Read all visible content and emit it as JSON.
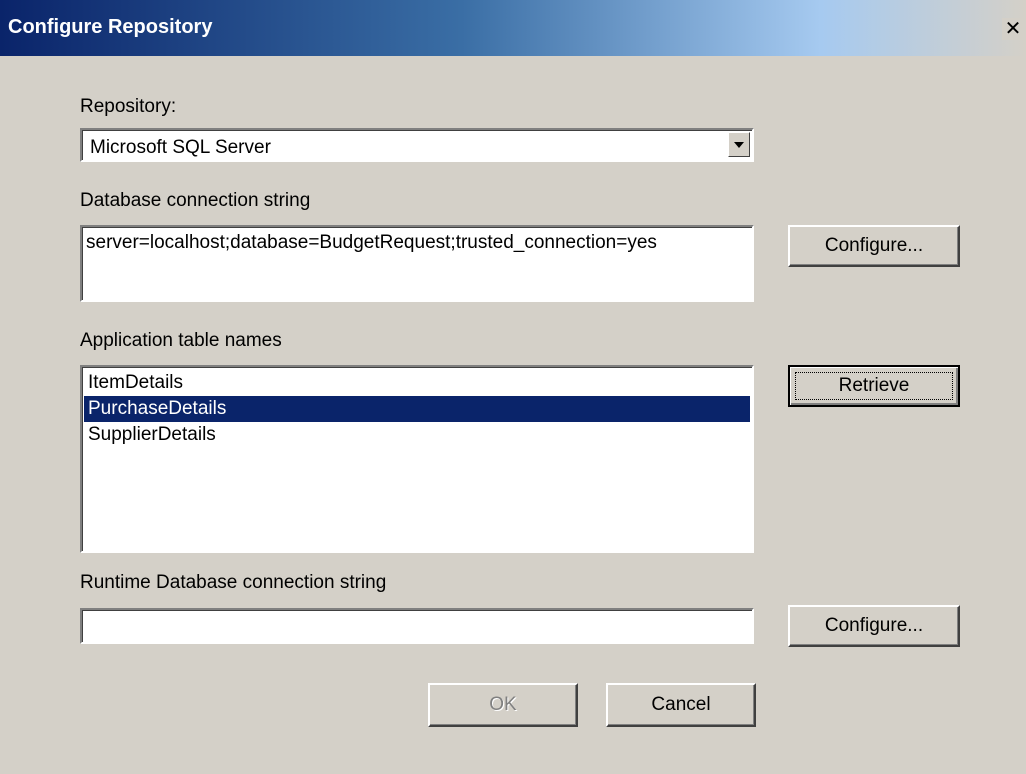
{
  "window": {
    "title": "Configure Repository",
    "close_glyph": "✕"
  },
  "repository": {
    "label": "Repository:",
    "selected": "Microsoft SQL Server"
  },
  "db_connection": {
    "label": "Database connection string",
    "value": "server=localhost;database=BudgetRequest;trusted_connection=yes",
    "configure_label": "Configure..."
  },
  "app_tables": {
    "label": "Application table names",
    "items": [
      "ItemDetails",
      "PurchaseDetails",
      "SupplierDetails"
    ],
    "selected_index": 1,
    "retrieve_label": "Retrieve"
  },
  "runtime_connection": {
    "label": "Runtime Database connection string",
    "value": "",
    "configure_label": "Configure..."
  },
  "footer": {
    "ok_label": "OK",
    "cancel_label": "Cancel"
  },
  "colors": {
    "titlebar_start": "#0a246a",
    "selection": "#0a246a",
    "dialog_bg": "#d4d0c8"
  }
}
